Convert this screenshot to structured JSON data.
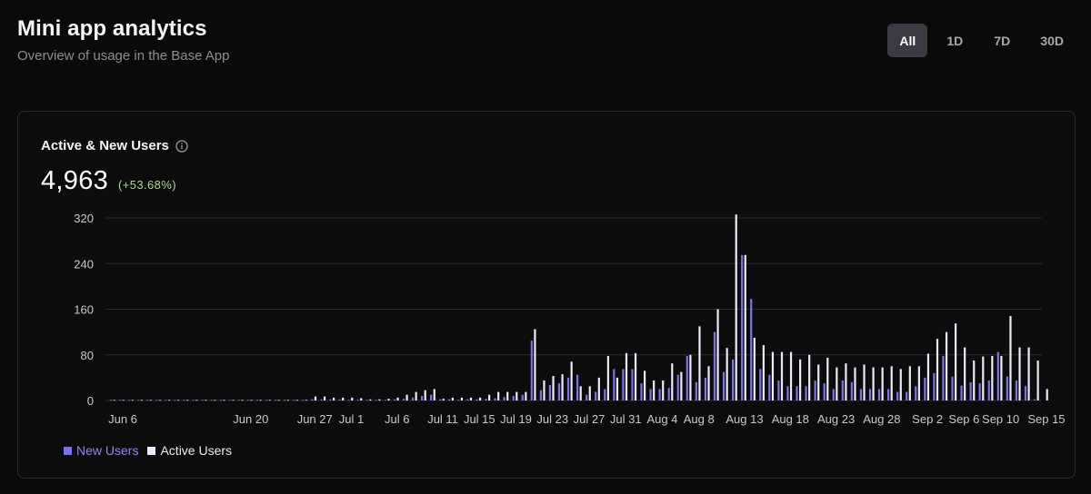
{
  "header": {
    "title": "Mini app analytics",
    "subtitle": "Overview of usage in the Base App"
  },
  "range_tabs": [
    {
      "label": "All",
      "active": true
    },
    {
      "label": "1D",
      "active": false
    },
    {
      "label": "7D",
      "active": false
    },
    {
      "label": "30D",
      "active": false
    }
  ],
  "card": {
    "title": "Active & New Users",
    "info_icon": "info-icon",
    "value": "4,963",
    "change": "(+53.68%)"
  },
  "colors": {
    "new_users": "#7b74e6",
    "active_users": "#eceaf8",
    "change_positive": "#a6db8f"
  },
  "chart_data": {
    "type": "bar",
    "title": "",
    "xlabel": "",
    "ylabel": "",
    "ylim": [
      0,
      320
    ],
    "yticks": [
      0,
      80,
      160,
      240,
      320
    ],
    "x_start": "Jun 6",
    "x_tick_labels": [
      "Jun 6",
      "Jun 20",
      "Jun 27",
      "Jul 1",
      "Jul 6",
      "Jul 11",
      "Jul 15",
      "Jul 19",
      "Jul 23",
      "Jul 27",
      "Jul 31",
      "Aug 4",
      "Aug 8",
      "Aug 13",
      "Aug 18",
      "Aug 23",
      "Aug 28",
      "Sep 2",
      "Sep 6",
      "Sep 10",
      "Sep 15"
    ],
    "x_tick_positions": [
      0,
      14,
      21,
      25,
      30,
      35,
      39,
      43,
      47,
      51,
      55,
      59,
      63,
      68,
      73,
      78,
      83,
      88,
      92,
      96,
      101
    ],
    "legend": {
      "position": "bottom-left"
    },
    "grid": true,
    "series": [
      {
        "name": "New Users",
        "values": [
          1,
          1,
          1,
          1,
          1,
          1,
          1,
          1,
          1,
          1,
          1,
          1,
          1,
          1,
          1,
          1,
          1,
          1,
          1,
          1,
          1,
          1,
          2,
          2,
          2,
          2,
          1,
          1,
          1,
          1,
          1,
          2,
          3,
          5,
          8,
          10,
          2,
          2,
          1,
          2,
          2,
          3,
          4,
          6,
          8,
          10,
          105,
          18,
          27,
          30,
          40,
          45,
          10,
          15,
          20,
          55,
          55,
          55,
          30,
          20,
          20,
          22,
          45,
          78,
          32,
          40,
          120,
          50,
          72,
          255,
          178,
          55,
          45,
          35,
          25,
          25,
          25,
          35,
          30,
          20,
          35,
          32,
          20,
          20,
          20,
          20,
          15,
          15,
          25,
          40,
          48,
          78,
          42,
          26,
          32,
          30,
          35,
          85,
          42,
          35,
          25,
          2
        ],
        "color": "#7b74e6"
      },
      {
        "name": "Active Users",
        "values": [
          1,
          1,
          1,
          1,
          1,
          1,
          1,
          1,
          1,
          1,
          1,
          1,
          1,
          1,
          1,
          1,
          1,
          1,
          1,
          1,
          1,
          1,
          7,
          7,
          5,
          5,
          5,
          4,
          2,
          2,
          3,
          5,
          10,
          15,
          18,
          20,
          3,
          5,
          5,
          5,
          5,
          10,
          15,
          15,
          15,
          15,
          125,
          35,
          43,
          46,
          68,
          25,
          25,
          40,
          78,
          40,
          83,
          83,
          52,
          35,
          35,
          65,
          50,
          80,
          130,
          60,
          160,
          92,
          326,
          255,
          110,
          97,
          85,
          85,
          85,
          72,
          80,
          63,
          75,
          58,
          65,
          58,
          63,
          58,
          58,
          60,
          55,
          60,
          60,
          82,
          108,
          120,
          135,
          93,
          70,
          77,
          78,
          78,
          148,
          93,
          93,
          70,
          20
        ],
        "color": "#eceaf8"
      }
    ]
  }
}
